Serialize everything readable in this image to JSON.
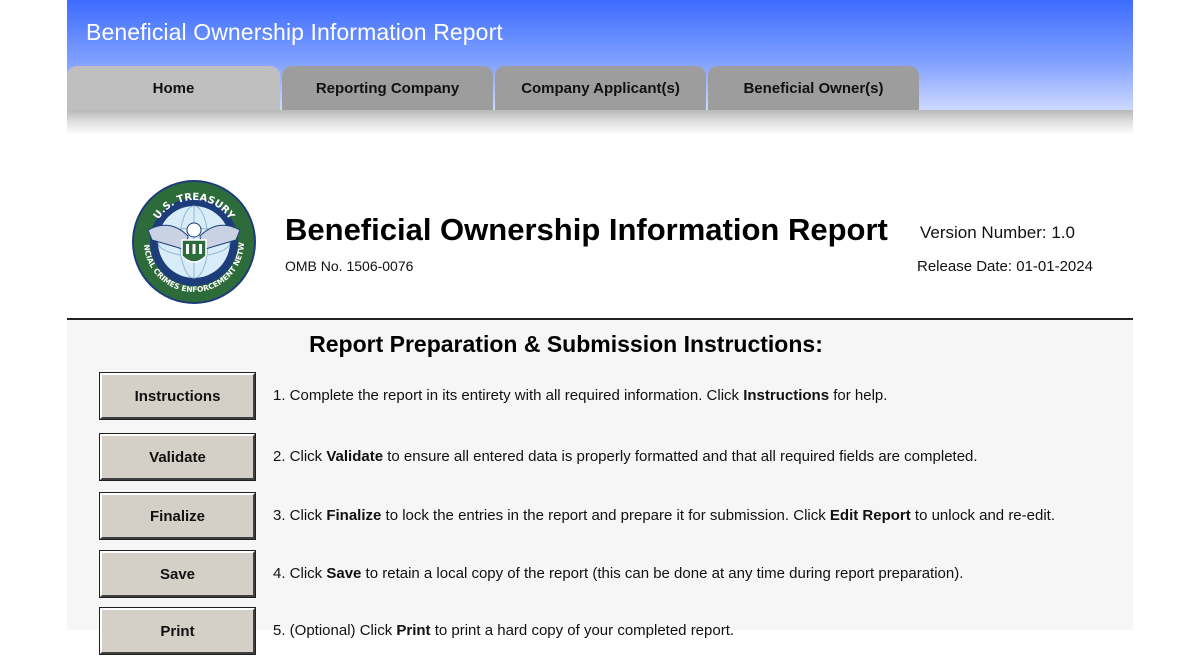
{
  "banner": {
    "title": "Beneficial Ownership Information Report"
  },
  "tabs": [
    {
      "label": "Home",
      "active": true
    },
    {
      "label": "Reporting Company",
      "active": false
    },
    {
      "label": "Company Applicant(s)",
      "active": false
    },
    {
      "label": "Beneficial Owner(s)",
      "active": false
    }
  ],
  "header": {
    "seal": {
      "icon": "fincen-seal-icon",
      "top_text": "U.S. TREASURY",
      "ring_text": "FINANCIAL CRIMES ENFORCEMENT NETWORK"
    },
    "title": "Beneficial Ownership Information Report",
    "omb": "OMB No. 1506-0076",
    "version": "Version Number:  1.0",
    "release": "Release Date: 01-01-2024"
  },
  "instructions": {
    "title": "Report Preparation & Submission Instructions:",
    "steps": [
      {
        "button": "Instructions",
        "pre": "1. Complete the report in its entirety with all required information. Click ",
        "bold": "Instructions",
        "post": " for help."
      },
      {
        "button": "Validate",
        "pre": "2. Click ",
        "bold": "Validate",
        "post": " to ensure all entered data is properly formatted and that all required fields are completed."
      },
      {
        "button": "Finalize",
        "pre": "3. Click ",
        "bold": "Finalize",
        "post": " to lock the entries in the report and prepare it for submission. Click ",
        "bold2": "Edit Report",
        "post2": " to unlock and re-edit."
      },
      {
        "button": "Save",
        "pre": "4. Click ",
        "bold": "Save",
        "post": " to retain a local copy of the report (this can be done at any time during report preparation)."
      },
      {
        "button": "Print",
        "pre": "5. (Optional) Click ",
        "bold": "Print",
        "post": " to print a hard copy of your completed report."
      }
    ]
  },
  "colors": {
    "banner_top": "#3d6cff",
    "banner_bottom": "#cdd9ff",
    "tab_active": "#bfbfbf",
    "tab_inactive": "#9d9d9d",
    "button_face": "#d4d0c8",
    "seal_green": "#2e6b3a",
    "seal_blue": "#1d3d7a"
  }
}
